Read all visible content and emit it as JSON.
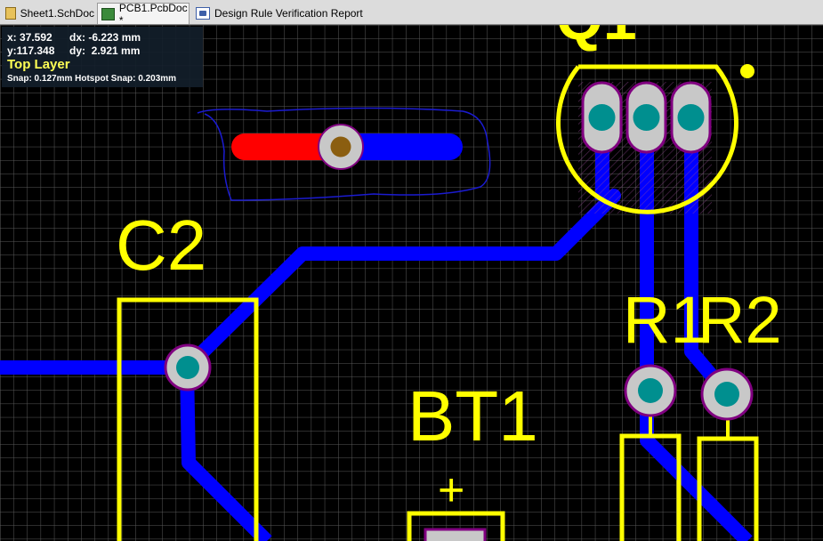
{
  "tabs": [
    {
      "label": "Sheet1.SchDoc",
      "icon": "schematic-doc-icon",
      "active": false
    },
    {
      "label": "PCB1.PcbDoc *",
      "icon": "pcb-doc-icon",
      "active": true
    },
    {
      "label": "Design Rule Verification Report",
      "icon": "report-doc-icon",
      "active": false
    }
  ],
  "hud": {
    "x": "x: 37.592",
    "dx": "dx: -6.223 mm",
    "y": "y:117.348",
    "dy": "dy:  2.921 mm",
    "layer": "Top Layer",
    "snap": "Snap: 0.127mm Hotspot Snap: 0.203mm"
  },
  "designators": {
    "q1": "Q1",
    "c2": "C2",
    "bt1": "BT1",
    "bt1_polarity": "+",
    "r1": "R1",
    "r2": "R2"
  },
  "colors": {
    "background": "#000000",
    "grid": "#5a5a5a",
    "top_layer_track": "#0000ff",
    "selected_track": "#ff0000",
    "overlay": "#ffff00",
    "pad_ring": "#c8c8c8",
    "pad_hole": "#008f8f",
    "via_hole": "#8b5e10",
    "outline": "#800080"
  }
}
